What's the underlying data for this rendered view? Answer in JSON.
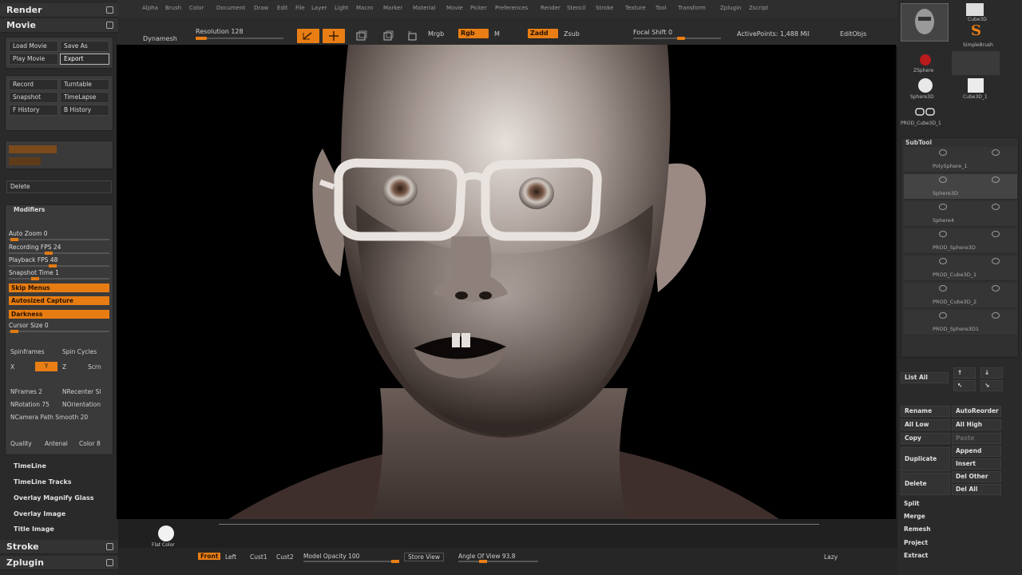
{
  "left_palette": {
    "render": "Render",
    "movie": "Movie",
    "buttons": {
      "load_movie": "Load Movie",
      "save_as": "Save As",
      "play_movie": "Play Movie",
      "export": "Export",
      "record": "Record",
      "turntable": "Turntable",
      "snapshot": "Snapshot",
      "timelapse": "TimeLapse",
      "f_history": "F History",
      "b_history": "B History",
      "delete": "Delete"
    },
    "modifiers": "Modifiers",
    "sliders": [
      {
        "label": "Auto Zoom 0",
        "pos": 0.02
      },
      {
        "label": "Recording FPS 24",
        "pos": 0.36
      },
      {
        "label": "Playback FPS 48",
        "pos": 0.4
      },
      {
        "label": "Snapshot Time 1",
        "pos": 0.22
      }
    ],
    "orange_buttons": [
      "Skip Menus",
      "Autosized Capture",
      "Darkness"
    ],
    "cursor_size": {
      "label": "Cursor Size 0",
      "pos": 0.02
    },
    "spin": {
      "spinframes": "Spinframes",
      "spin_cycles": "Spin Cycles",
      "x": "X",
      "y": "Y",
      "z": "Z",
      "scrn": "Scrn"
    },
    "sliders2": [
      {
        "label": "NFrames 2",
        "label2": "NRecenter Sl"
      },
      {
        "label": "NRotation 75",
        "label2": "NOrientation"
      },
      {
        "label": "NCamera Path Smooth 20",
        "label2": ""
      }
    ],
    "quality_row": {
      "quality": "Quality",
      "antenna": "Antenal",
      "color": "Color 8"
    },
    "sub_items": [
      "TimeLine",
      "TimeLine Tracks",
      "Overlay Magnify Glass",
      "Overlay Image",
      "Title Image"
    ],
    "stroke": "Stroke",
    "zplugin": "Zplugin"
  },
  "menu": [
    "Alpha",
    "Brush",
    "Color",
    "Document",
    "Draw",
    "Edit",
    "File",
    "Layer",
    "Light",
    "Macro",
    "Marker",
    "Material",
    "Movie",
    "Picker",
    "Preferences",
    "Render",
    "Stencil",
    "Stroke",
    "Texture",
    "Tool",
    "Transform",
    "Zplugin",
    "Zscript"
  ],
  "shelf": {
    "dynamesh": "Dynamesh",
    "resolution": "Resolution 128",
    "mrgb": "Mrgb",
    "rgb": "Rgb",
    "m": "M",
    "zadd": "Zadd",
    "zsub": "Zsub",
    "focal_shift": "Focal Shift 0",
    "active_points": "ActivePoints: 1,488 Mil",
    "edit_objs": "EditObjs"
  },
  "bottom": {
    "flat_color": "Flat Color",
    "front": "Front",
    "left": "Left",
    "cust1": "Cust1",
    "cust2": "Cust2",
    "model_opacity": "Model Opacity 100",
    "store_view": "Store View",
    "angle_of_view": "Angle Of View 93.8",
    "lazy": "Lazy"
  },
  "right_palette": {
    "tools": [
      {
        "label": "Cube3D"
      },
      {
        "label": "SimpleBrush"
      },
      {
        "label": "ZSphere"
      },
      {
        "label": "Sphere3D"
      },
      {
        "label": "Cube3D_1"
      },
      {
        "label": "PROD_Cube3D_1"
      }
    ],
    "subtool": "SubTool",
    "subtool_names": [
      "PolySphere_1",
      "Sphere3D",
      "Sphere4",
      "PROD_Sphere3D",
      "PROD_Cube3D_1",
      "PROD_Cube3D_2",
      "PROD_Sphere3D1"
    ],
    "list_all": "List All",
    "buttons": [
      [
        "Rename",
        "AutoReorder"
      ],
      [
        "All Low",
        "All High"
      ],
      [
        "Copy",
        "Paste"
      ],
      [
        "Duplicate",
        "Append"
      ],
      [
        "",
        "Insert"
      ],
      [
        "Delete",
        "Del Other"
      ],
      [
        "",
        "Del All"
      ],
      [
        "Split",
        ""
      ],
      [
        "Merge",
        ""
      ],
      [
        "Remesh",
        ""
      ],
      [
        "Project",
        ""
      ],
      [
        "Extract",
        ""
      ]
    ]
  },
  "colors": {
    "accent": "#e87e14"
  }
}
